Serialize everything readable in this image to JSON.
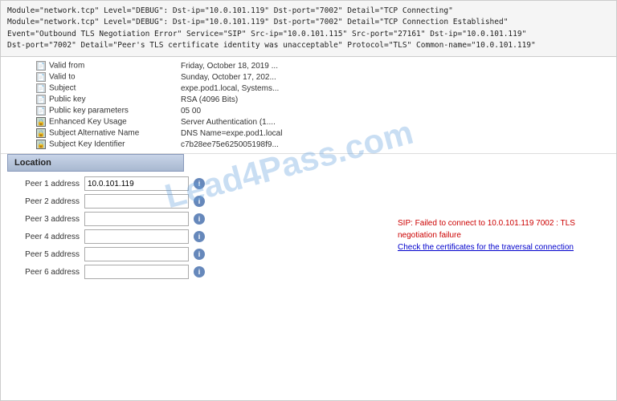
{
  "log": {
    "lines": [
      "Module=\"network.tcp\" Level=\"DEBUG\":  Dst-ip=\"10.0.101.119\" Dst-port=\"7002\" Detail=\"TCP Connecting\"",
      "Module=\"network.tcp\" Level=\"DEBUG\":  Dst-ip=\"10.0.101.119\" Dst-port=\"7002\" Detail=\"TCP Connection Established\"",
      "Event=\"Outbound TLS Negotiation Error\" Service=\"SIP\" Src-ip=\"10.0.101.115\" Src-port=\"27161\" Dst-ip=\"10.0.101.119\"",
      "    Dst-port=\"7002\" Detail=\"Peer's TLS certificate identity was unacceptable\" Protocol=\"TLS\" Common-name=\"10.0.101.119\""
    ]
  },
  "certificate": {
    "fields": [
      {
        "icon": "doc",
        "label": "Valid from",
        "value": "Friday, October 18, 2019 ..."
      },
      {
        "icon": "doc",
        "label": "Valid to",
        "value": "Sunday, October 17, 202..."
      },
      {
        "icon": "doc",
        "label": "Subject",
        "value": "expe.pod1.local, Systems..."
      },
      {
        "icon": "doc",
        "label": "Public key",
        "value": "RSA (4096 Bits)"
      },
      {
        "icon": "doc",
        "label": "Public key parameters",
        "value": "05 00"
      },
      {
        "icon": "lock",
        "label": "Enhanced Key Usage",
        "value": "Server Authentication (1...."
      },
      {
        "icon": "lock",
        "label": "Subject Alternative Name",
        "value": "DNS Name=expe.pod1.local"
      },
      {
        "icon": "lock",
        "label": "Subject Key Identifier",
        "value": "c7b28ee75e625005198f9..."
      }
    ]
  },
  "location": {
    "header": "Location",
    "peers": [
      {
        "label": "Peer 1 address",
        "value": "10.0.101.119"
      },
      {
        "label": "Peer 2 address",
        "value": ""
      },
      {
        "label": "Peer 3 address",
        "value": ""
      },
      {
        "label": "Peer 4 address",
        "value": ""
      },
      {
        "label": "Peer 5 address",
        "value": ""
      },
      {
        "label": "Peer 6 address",
        "value": ""
      }
    ]
  },
  "error": {
    "main_text": "SIP: Failed to connect to 10.0.101.119 7002 : TLS negotiation failure",
    "link_text": "Check the certificates for the traversal connection"
  },
  "watermark": {
    "text": "Lead4Pass.com"
  }
}
